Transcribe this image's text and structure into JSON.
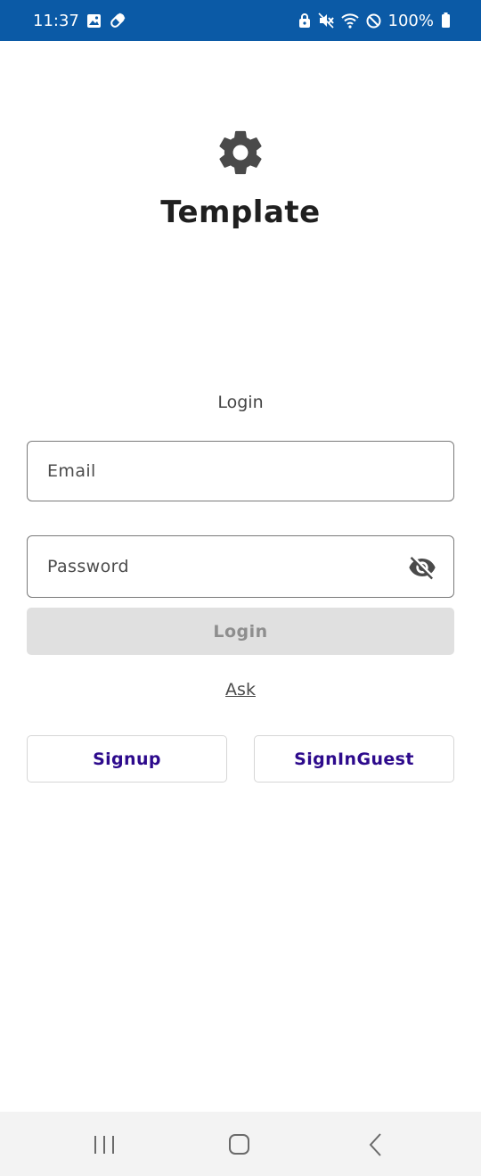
{
  "status_bar": {
    "time": "11:37",
    "battery": "100%",
    "icons_left": [
      "gallery-icon",
      "pill-icon"
    ],
    "icons_right": [
      "lock-icon",
      "mute-icon",
      "wifi-icon",
      "do-not-disturb-icon",
      "battery-icon"
    ]
  },
  "header": {
    "logo_icon": "gear-icon",
    "title": "Template"
  },
  "form": {
    "heading": "Login",
    "email_placeholder": "Email",
    "password_placeholder": "Password",
    "password_toggle_icon": "eye-off-icon",
    "login_label": "Login",
    "ask_label": "Ask",
    "signup_label": "Signup",
    "guest_label": "SignInGuest"
  },
  "nav": {
    "recent_icon": "recent-apps-icon",
    "home_icon": "home-icon",
    "back_icon": "back-icon"
  },
  "colors": {
    "status_bar": "#0b5aa6",
    "button_text_accent": "#2d0a8c",
    "disabled_button": "#e0e0e0"
  }
}
